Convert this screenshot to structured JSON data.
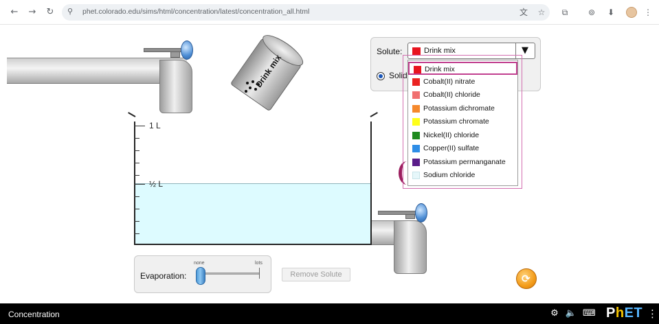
{
  "browser": {
    "back": "←",
    "forward": "→",
    "reload": "↻",
    "site_icon": "⚲",
    "url": "phet.colorado.edu/sims/html/concentration/latest/concentration_all.html",
    "icons": {
      "translate": "文",
      "bookmark": "☆",
      "extensions": "⧉",
      "media": "⊚",
      "downloads": "⬇",
      "menu": "⋮"
    }
  },
  "shaker": {
    "label": "Drink mix"
  },
  "beaker": {
    "full_label": "1 L",
    "half_label": "½ L"
  },
  "solute_panel": {
    "label": "Solute:",
    "selected": "Drink mix",
    "selected_color": "#e8141f",
    "arrow": "▼",
    "radio_label": "Solid"
  },
  "dropdown": {
    "items": [
      {
        "label": "Drink mix",
        "color": "#e8141f"
      },
      {
        "label": "Cobalt(II) nitrate",
        "color": "#ea2322"
      },
      {
        "label": "Cobalt(II) chloride",
        "color": "#f07070"
      },
      {
        "label": "Potassium dichromate",
        "color": "#f5892c"
      },
      {
        "label": "Potassium chromate",
        "color": "#ffff1a"
      },
      {
        "label": "Nickel(II) chloride",
        "color": "#1f8a1f"
      },
      {
        "label": "Copper(II) sulfate",
        "color": "#2e8de6"
      },
      {
        "label": "Potassium permanganate",
        "color": "#5a1d8a"
      },
      {
        "label": "Sodium chloride",
        "color": "#e6f7fa"
      }
    ],
    "highlighted": "Drink mix"
  },
  "evaporation": {
    "label": "Evaporation:",
    "min": "none",
    "max": "lots",
    "level": 0
  },
  "remove_solute": "Remove Solute",
  "reset": "⟳",
  "bottom_bar": {
    "title": "Concentration",
    "icons": {
      "settings": "⚙",
      "sound": "🔈",
      "keyboard": "⌨"
    },
    "logo": {
      "p": "P",
      "h": "h",
      "et": "ET"
    },
    "menu": "⋮"
  }
}
